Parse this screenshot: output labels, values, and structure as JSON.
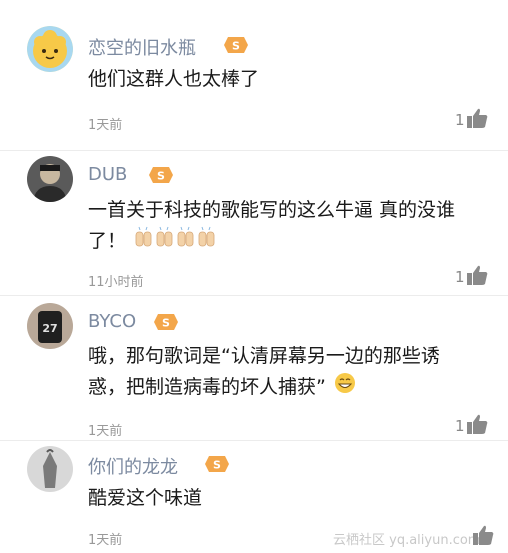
{
  "comments": [
    {
      "username": "恋空的旧水瓶",
      "line1": "他们这群人也太棒了",
      "line2": "",
      "time": "1天前",
      "likes": "1"
    },
    {
      "username": "DUB",
      "line1": "一首关于科技的歌能写的这么牛逼 真的没谁",
      "line2": "了！",
      "time": "11小时前",
      "likes": "1"
    },
    {
      "username": "BYCO",
      "line1": "哦，那句歌词是“认清屏幕另一边的那些诱",
      "line2": "惑，把制造病毒的坏人捕获”",
      "time": "1天前",
      "likes": "1"
    },
    {
      "username": "你们的龙龙",
      "line1": "酷爱这个味道",
      "line2": "",
      "time": "1天前",
      "likes": ""
    }
  ],
  "watermark": "云栖社区 yq.aliyun.com",
  "colors": {
    "username": "#7c8aa0",
    "badge": "#f3a64a",
    "thumb": "#8a8a8a"
  }
}
